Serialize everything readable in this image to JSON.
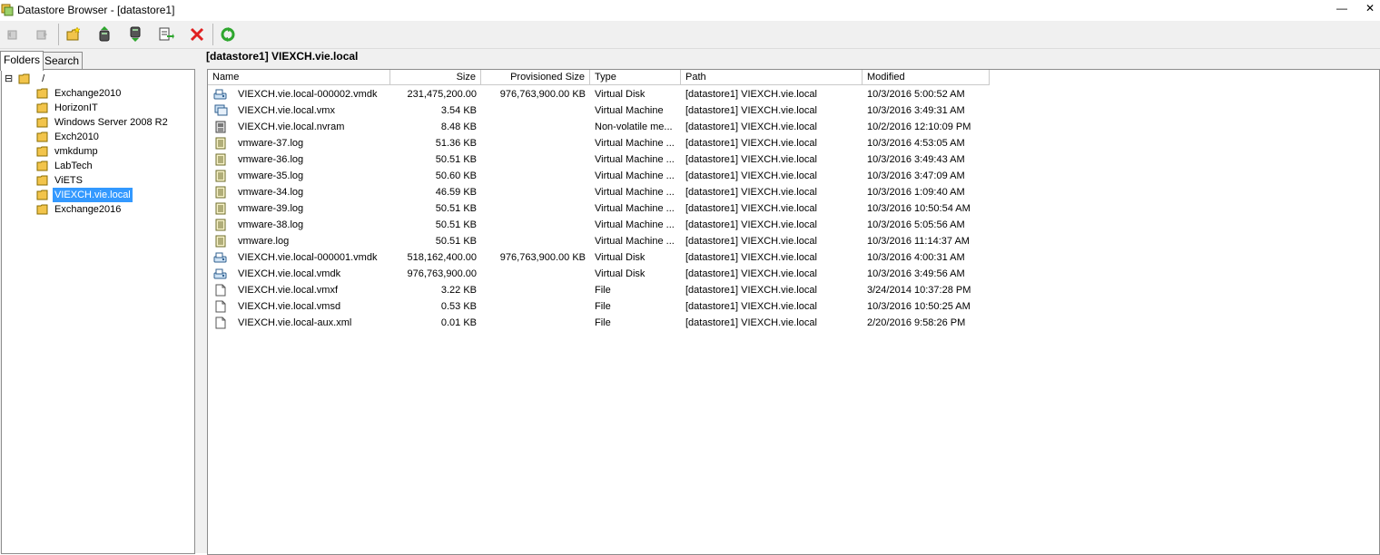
{
  "window": {
    "title": "Datastore Browser - [datastore1]",
    "minimize_glyph": "—",
    "close_glyph": "✕"
  },
  "toolbar": {
    "buttons": [
      {
        "name": "back-icon",
        "enabled": false
      },
      {
        "name": "forward-icon",
        "enabled": false
      },
      {
        "name": "new-folder-icon",
        "enabled": true
      },
      {
        "name": "upload-icon",
        "enabled": true
      },
      {
        "name": "download-icon",
        "enabled": true
      },
      {
        "name": "register-vm-icon",
        "enabled": true
      },
      {
        "name": "delete-icon",
        "enabled": true
      },
      {
        "name": "refresh-icon",
        "enabled": true
      }
    ]
  },
  "left": {
    "tabs": [
      "Folders",
      "Search"
    ],
    "active_tab": "Folders",
    "root": {
      "expander": "⊟",
      "label": "/"
    },
    "folders": [
      "Exchange2010",
      "HorizonIT",
      "Windows Server 2008 R2",
      "Exch2010",
      "vmkdump",
      "LabTech",
      "ViETS",
      "VIEXCH.vie.local",
      "Exchange2016"
    ],
    "selected_folder": "VIEXCH.vie.local"
  },
  "right": {
    "path": "[datastore1] VIEXCH.vie.local",
    "columns": [
      "Name",
      "Size",
      "Provisioned Size",
      "Type",
      "Path",
      "Modified"
    ],
    "rows": [
      {
        "icon": "virtual-disk-icon",
        "name": "VIEXCH.vie.local-000002.vmdk",
        "size": "231,475,200.00",
        "prov": "976,763,900.00 KB",
        "type": "Virtual Disk",
        "path": "[datastore1] VIEXCH.vie.local",
        "modified": "10/3/2016 5:00:52 AM"
      },
      {
        "icon": "virtual-machine-icon",
        "name": "VIEXCH.vie.local.vmx",
        "size": "3.54 KB",
        "prov": "",
        "type": "Virtual Machine",
        "path": "[datastore1] VIEXCH.vie.local",
        "modified": "10/3/2016 3:49:31 AM"
      },
      {
        "icon": "nvram-icon",
        "name": "VIEXCH.vie.local.nvram",
        "size": "8.48 KB",
        "prov": "",
        "type": "Non-volatile me...",
        "path": "[datastore1] VIEXCH.vie.local",
        "modified": "10/2/2016 12:10:09 PM"
      },
      {
        "icon": "log-file-icon",
        "name": "vmware-37.log",
        "size": "51.36 KB",
        "prov": "",
        "type": "Virtual Machine ...",
        "path": "[datastore1] VIEXCH.vie.local",
        "modified": "10/3/2016 4:53:05 AM"
      },
      {
        "icon": "log-file-icon",
        "name": "vmware-36.log",
        "size": "50.51 KB",
        "prov": "",
        "type": "Virtual Machine ...",
        "path": "[datastore1] VIEXCH.vie.local",
        "modified": "10/3/2016 3:49:43 AM"
      },
      {
        "icon": "log-file-icon",
        "name": "vmware-35.log",
        "size": "50.60 KB",
        "prov": "",
        "type": "Virtual Machine ...",
        "path": "[datastore1] VIEXCH.vie.local",
        "modified": "10/3/2016 3:47:09 AM"
      },
      {
        "icon": "log-file-icon",
        "name": "vmware-34.log",
        "size": "46.59 KB",
        "prov": "",
        "type": "Virtual Machine ...",
        "path": "[datastore1] VIEXCH.vie.local",
        "modified": "10/3/2016 1:09:40 AM"
      },
      {
        "icon": "log-file-icon",
        "name": "vmware-39.log",
        "size": "50.51 KB",
        "prov": "",
        "type": "Virtual Machine ...",
        "path": "[datastore1] VIEXCH.vie.local",
        "modified": "10/3/2016 10:50:54 AM"
      },
      {
        "icon": "log-file-icon",
        "name": "vmware-38.log",
        "size": "50.51 KB",
        "prov": "",
        "type": "Virtual Machine ...",
        "path": "[datastore1] VIEXCH.vie.local",
        "modified": "10/3/2016 5:05:56 AM"
      },
      {
        "icon": "log-file-icon",
        "name": "vmware.log",
        "size": "50.51 KB",
        "prov": "",
        "type": "Virtual Machine ...",
        "path": "[datastore1] VIEXCH.vie.local",
        "modified": "10/3/2016 11:14:37 AM"
      },
      {
        "icon": "virtual-disk-icon",
        "name": "VIEXCH.vie.local-000001.vmdk",
        "size": "518,162,400.00",
        "prov": "976,763,900.00 KB",
        "type": "Virtual Disk",
        "path": "[datastore1] VIEXCH.vie.local",
        "modified": "10/3/2016 4:00:31 AM"
      },
      {
        "icon": "virtual-disk-icon",
        "name": "VIEXCH.vie.local.vmdk",
        "size": "976,763,900.00",
        "prov": "",
        "type": "Virtual Disk",
        "path": "[datastore1] VIEXCH.vie.local",
        "modified": "10/3/2016 3:49:56 AM"
      },
      {
        "icon": "file-icon",
        "name": "VIEXCH.vie.local.vmxf",
        "size": "3.22 KB",
        "prov": "",
        "type": "File",
        "path": "[datastore1] VIEXCH.vie.local",
        "modified": "3/24/2014 10:37:28 PM"
      },
      {
        "icon": "file-icon",
        "name": "VIEXCH.vie.local.vmsd",
        "size": "0.53 KB",
        "prov": "",
        "type": "File",
        "path": "[datastore1] VIEXCH.vie.local",
        "modified": "10/3/2016 10:50:25 AM"
      },
      {
        "icon": "file-icon",
        "name": "VIEXCH.vie.local-aux.xml",
        "size": "0.01 KB",
        "prov": "",
        "type": "File",
        "path": "[datastore1] VIEXCH.vie.local",
        "modified": "2/20/2016 9:58:26 PM"
      }
    ]
  },
  "colors": {
    "selection": "#3399ff",
    "folder": "#f2c44b",
    "delete": "#e02020",
    "refresh": "#2ea62e"
  }
}
